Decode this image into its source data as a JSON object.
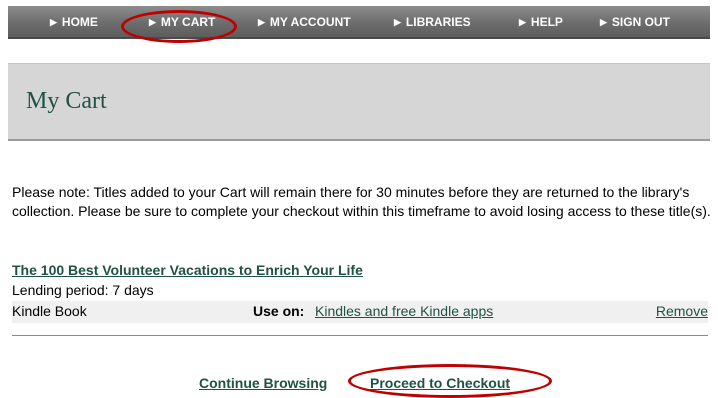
{
  "nav": {
    "home": "HOME",
    "my_cart": "MY CART",
    "my_account": "MY ACCOUNT",
    "libraries": "LIBRARIES",
    "help": "HELP",
    "sign_out": "SIGN OUT"
  },
  "page": {
    "title": "My Cart",
    "notice": "Please note: Titles added to your Cart will remain there for 30 minutes before they are returned to the library's collection. Please be sure to complete your checkout within this timeframe to avoid losing access to these title(s)."
  },
  "cart_item": {
    "title": "The 100 Best Volunteer Vacations to Enrich Your Life",
    "lending_period": "Lending period: 7 days",
    "format": "Kindle Book",
    "use_on_label": "Use on:",
    "use_on_link": "Kindles and free Kindle apps",
    "remove": "Remove"
  },
  "actions": {
    "continue_browsing": "Continue Browsing",
    "proceed_to_checkout": "Proceed to Checkout"
  },
  "colors": {
    "link_green": "#1f5245",
    "highlight_circle": "#c00000",
    "nav_gray": "#6f6f6f"
  }
}
